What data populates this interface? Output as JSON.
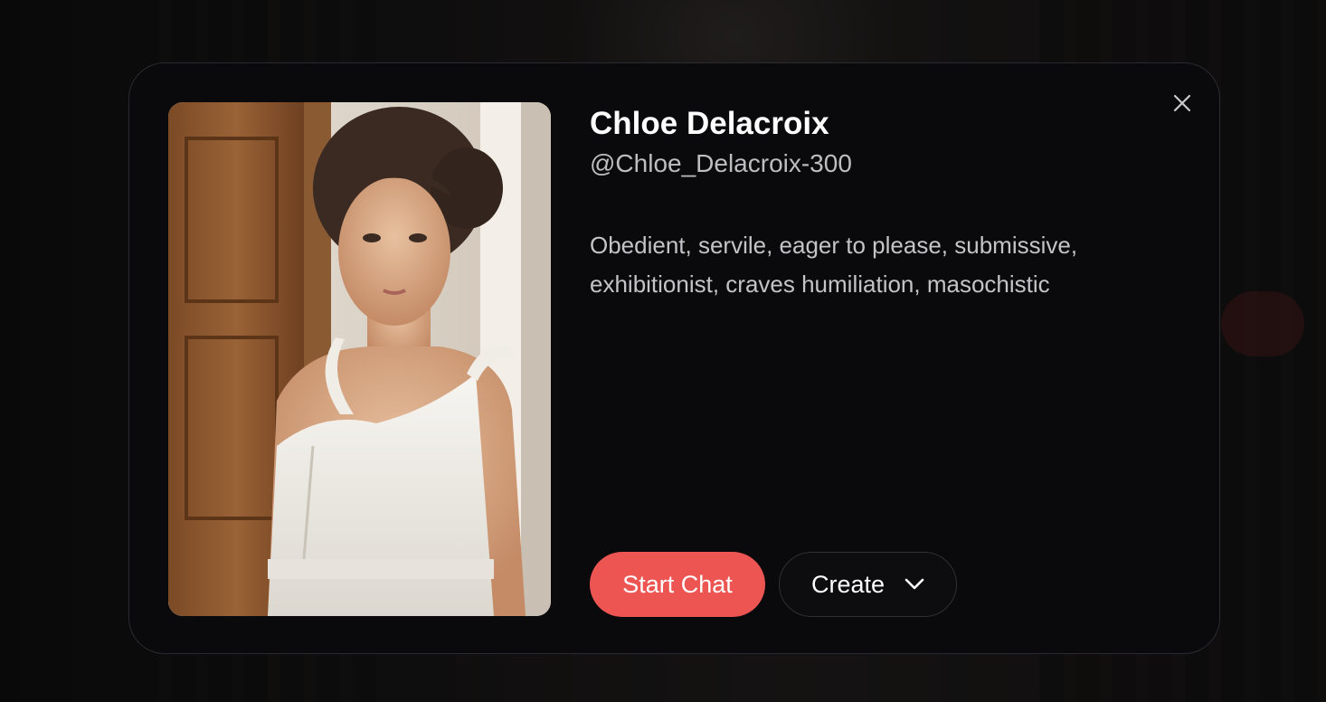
{
  "character": {
    "name": "Chloe Delacroix",
    "handle": "@Chloe_Delacroix-300",
    "description": "Obedient, servile, eager to please, submissive, exhibitionist, craves humiliation, masochistic"
  },
  "actions": {
    "start_chat_label": "Start Chat",
    "create_label": "Create"
  },
  "icons": {
    "close": "close-icon",
    "dropdown": "chevron-down-icon"
  },
  "colors": {
    "accent": "#ec5552",
    "modal_bg": "#0a0a0c",
    "text_primary": "#ffffff",
    "text_secondary": "#c3c3c8"
  }
}
